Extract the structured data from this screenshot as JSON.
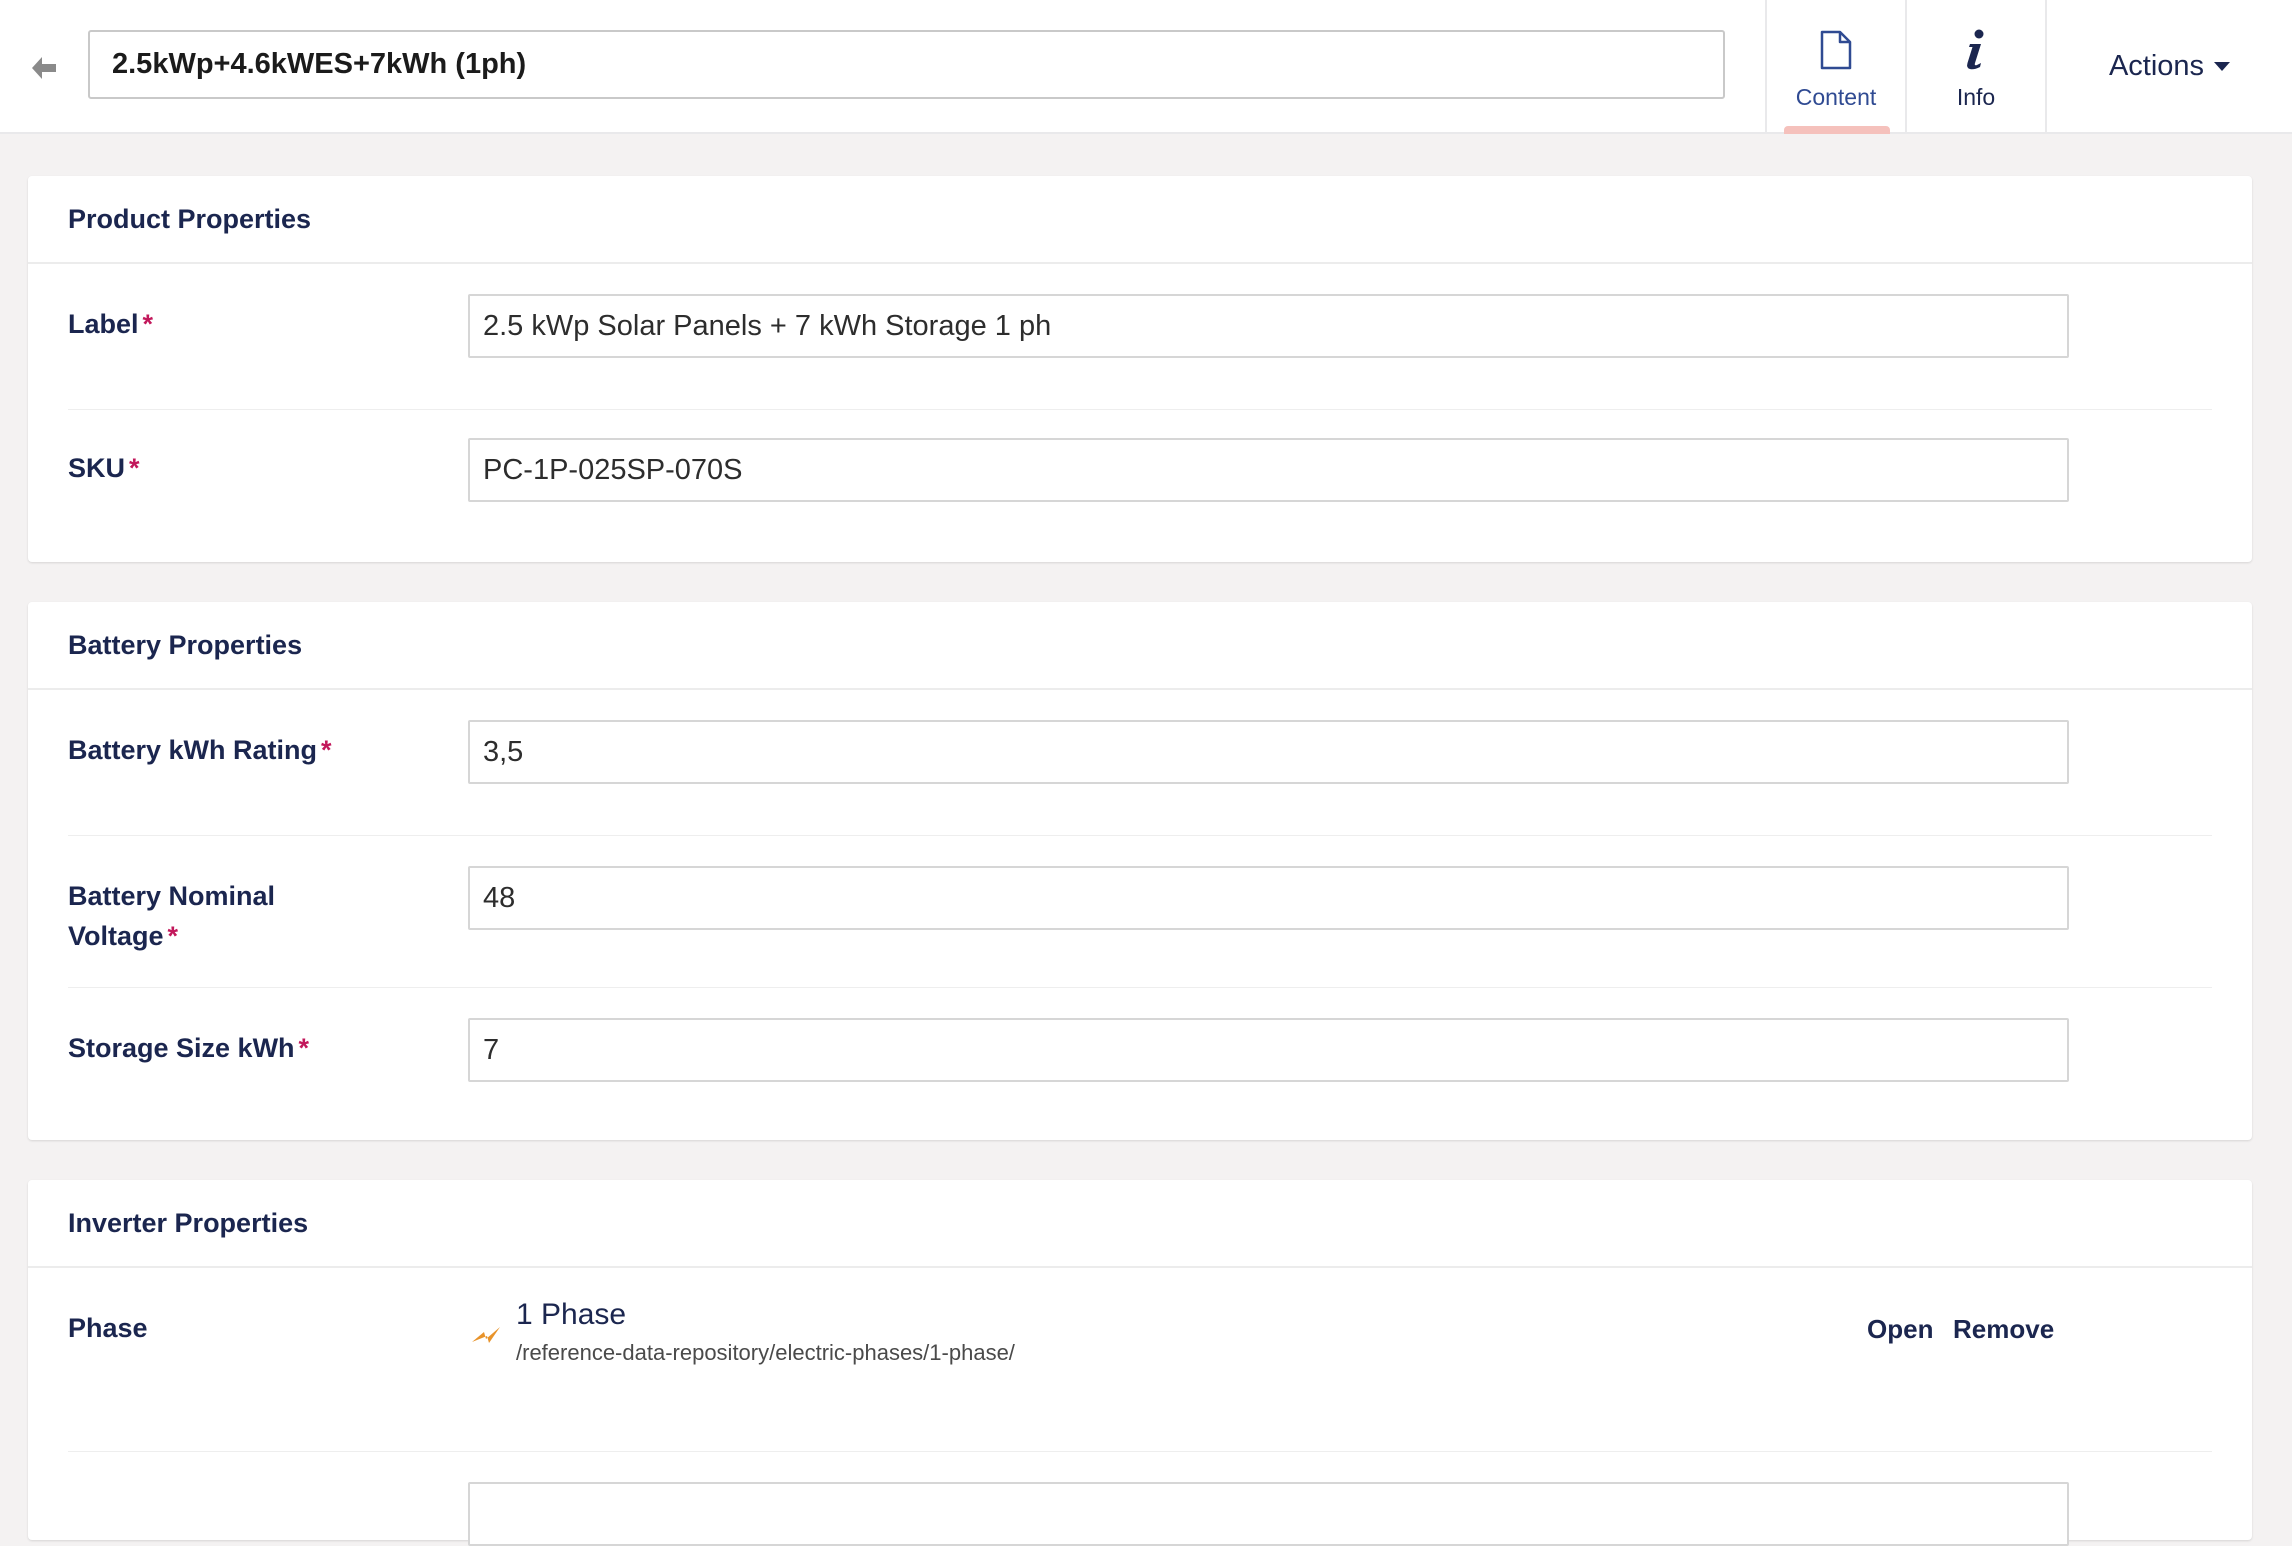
{
  "header": {
    "back_icon": "arrow-left-icon",
    "name_value": "2.5kWp+4.6kWES+7kWh (1ph)",
    "tabs": [
      {
        "label": "Content",
        "icon": "document-icon",
        "active": true
      },
      {
        "label": "Info",
        "icon": "info-icon",
        "active": false
      }
    ],
    "actions_label": "Actions",
    "accent_color": "#f5c1bc"
  },
  "product_properties": {
    "title": "Product Properties",
    "fields": [
      {
        "label": "Label",
        "required": true,
        "value": "2.5 kWp Solar Panels + 7 kWh Storage 1 ph"
      },
      {
        "label": "SKU",
        "required": true,
        "value": "PC-1P-025SP-070S"
      }
    ]
  },
  "battery_properties": {
    "title": "Battery Properties",
    "fields": [
      {
        "label": "Battery kWh Rating",
        "required": true,
        "value": "3,5"
      },
      {
        "label_line1": "Battery Nominal",
        "label_line2": "Voltage",
        "required": true,
        "value": "48"
      },
      {
        "label": "Storage Size kWh",
        "required": true,
        "value": "7"
      }
    ]
  },
  "inverter_properties": {
    "title": "Inverter Properties",
    "phase": {
      "label": "Phase",
      "picker_icon": "lightning-icon",
      "name": "1 Phase",
      "path": "/reference-data-repository/electric-phases/1-phase/",
      "open_label": "Open",
      "remove_label": "Remove"
    }
  },
  "required_marker": "*"
}
